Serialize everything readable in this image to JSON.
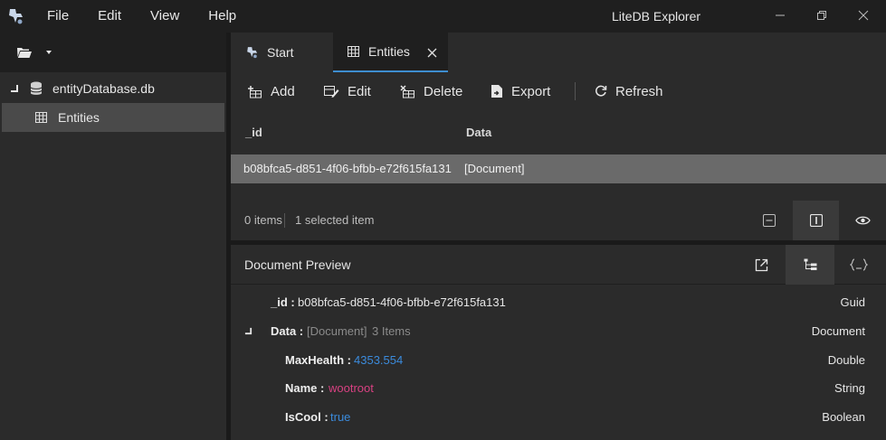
{
  "window": {
    "title": "LiteDB Explorer",
    "menu": [
      "File",
      "Edit",
      "View",
      "Help"
    ]
  },
  "sidebar": {
    "database": "entityDatabase.db",
    "collection": "Entities"
  },
  "tabs": [
    {
      "label": "Start"
    },
    {
      "label": "Entities"
    }
  ],
  "actions": {
    "add": "Add",
    "edit": "Edit",
    "delete": "Delete",
    "export": "Export",
    "refresh": "Refresh"
  },
  "grid": {
    "columns": [
      "_id",
      "Data"
    ],
    "rows": [
      {
        "id": "b08bfca5-d851-4f06-bfbb-e72f615fa131",
        "data": "[Document]"
      }
    ]
  },
  "status": {
    "items": "0 items",
    "selected": "1 selected item"
  },
  "preview": {
    "title": "Document Preview",
    "id_key": "_id :",
    "id_value": "b08bfca5-d851-4f06-bfbb-e72f615fa131",
    "id_type": "Guid",
    "data_key": "Data :",
    "data_value": "[Document]",
    "data_count": "3 Items",
    "data_type": "Document",
    "fields": [
      {
        "key": "MaxHealth :",
        "value": "4353.554",
        "type": "Double"
      },
      {
        "key": "Name :",
        "value": "wootroot",
        "type": "String"
      },
      {
        "key": "IsCool :",
        "value": "true",
        "type": "Boolean"
      }
    ]
  },
  "colors": {
    "accent": "#3e8ed0",
    "number": "#3b8bdc",
    "string": "#d94182",
    "selection": "#6a6a6a"
  },
  "icons": [
    "app-icon",
    "folder-open-icon",
    "caret-down-icon",
    "database-icon",
    "table-icon",
    "start-icon",
    "close-icon",
    "add-icon",
    "edit-icon",
    "delete-icon",
    "export-icon",
    "refresh-icon",
    "collapse-icon",
    "split-view-icon",
    "eye-icon",
    "external-link-icon",
    "tree-view-icon",
    "json-view-icon"
  ]
}
